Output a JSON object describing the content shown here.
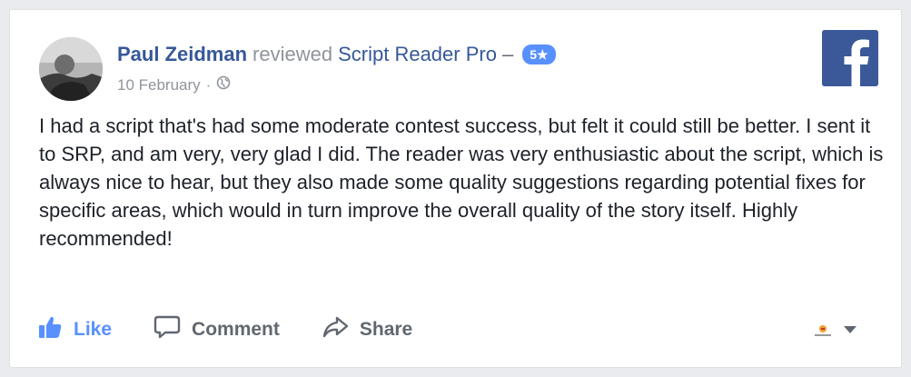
{
  "post": {
    "author": "Paul Zeidman",
    "action_text": "reviewed",
    "page_name": "Script Reader Pro",
    "separator": "–",
    "rating_badge": "5★",
    "date": "10 February",
    "meta_separator": "·",
    "privacy_icon": "globe-icon",
    "body": "I had a script that's had some moderate contest success, but felt it could still be better. I sent it to SRP, and am very, very glad I did. The reader was very enthusiastic about the script, which is always nice to hear, but they also made some quality suggestions regarding potential fixes for specific areas, which would in turn improve the overall quality of the story itself. Highly recommended!"
  },
  "brand": {
    "logo_icon": "facebook-logo-icon",
    "color": "#3b5998",
    "link_color": "#365899",
    "accent": "#5890ff"
  },
  "actions": {
    "like_label": "Like",
    "comment_label": "Comment",
    "share_label": "Share",
    "like_icon": "thumbs-up-icon",
    "comment_icon": "comment-bubble-icon",
    "share_icon": "share-arrow-icon",
    "menu_icon": "chevron-down-icon"
  }
}
